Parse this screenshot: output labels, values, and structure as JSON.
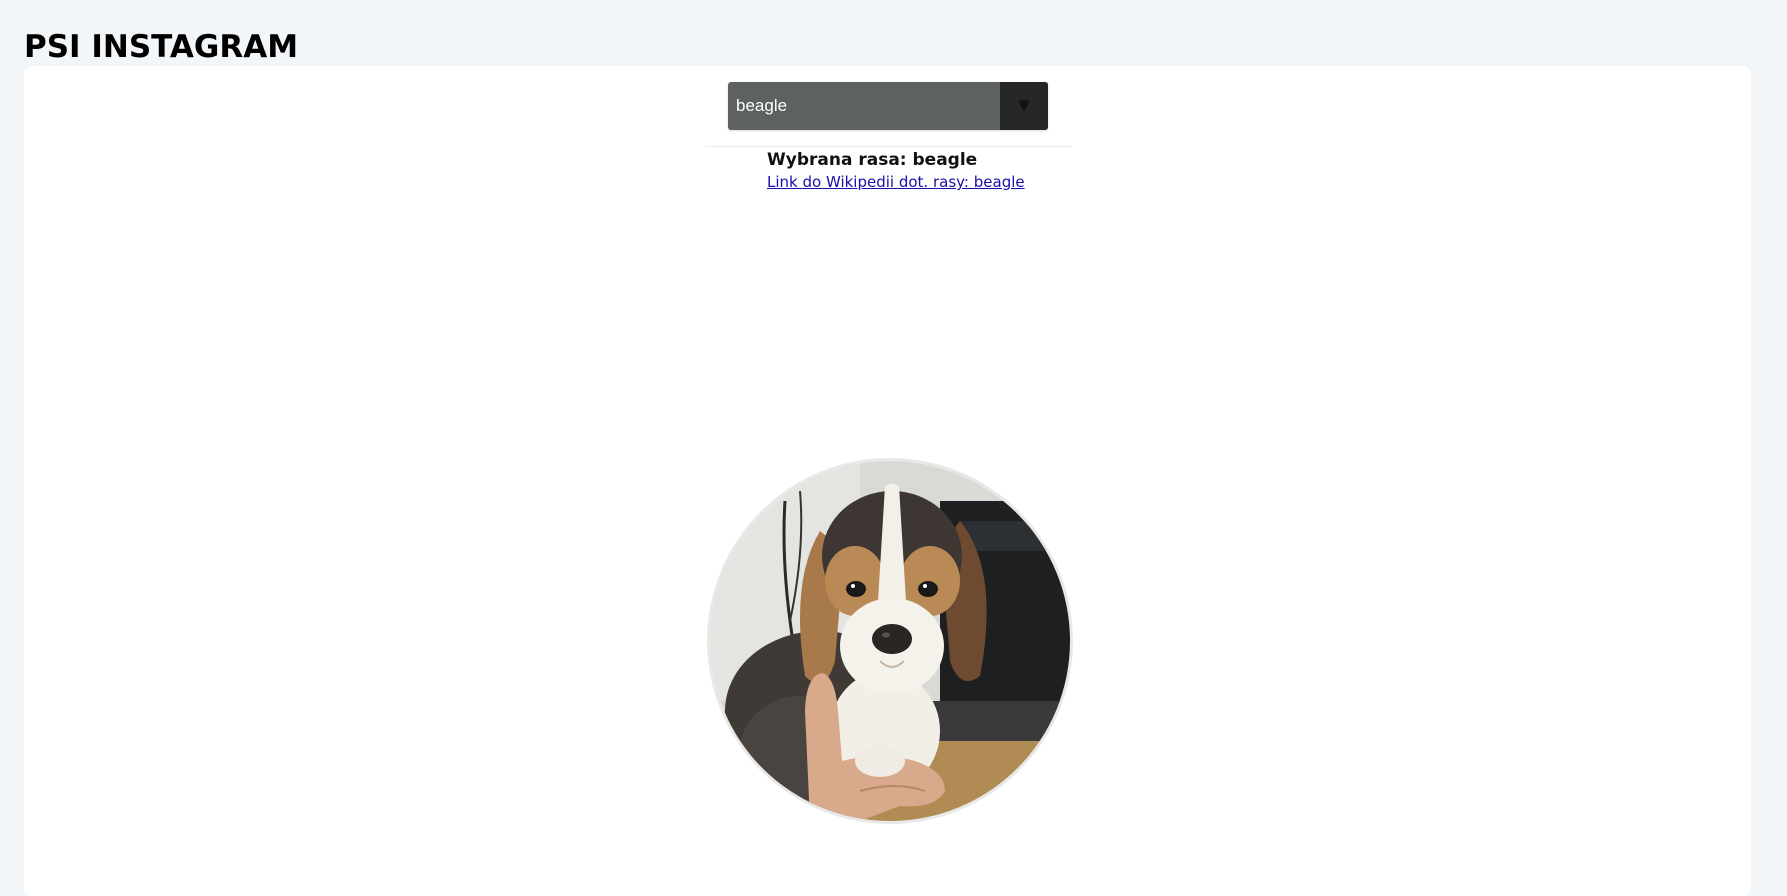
{
  "header": {
    "title": "PSI INSTAGRAM"
  },
  "breed_select": {
    "selected_value": "beagle",
    "arrow_glyph": "▼"
  },
  "breed_info": {
    "heading": "Wybrana rasa: beagle",
    "wiki_link_text": "Link do Wikipedii dot. rasy: beagle"
  },
  "photo": {
    "subject": "beagle puppy photo"
  },
  "colors": {
    "page_background": "#f3f6f9",
    "card_background": "#ffffff",
    "select_background": "#5d6260",
    "select_arrow_background": "#262828",
    "link": "#1a0dab"
  }
}
